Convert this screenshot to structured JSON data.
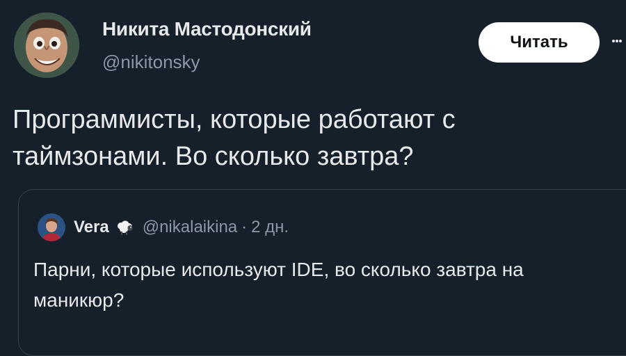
{
  "author": {
    "name": "Никита Мастодонский",
    "handle": "@nikitonsky"
  },
  "follow_button": {
    "label": "Читать"
  },
  "tweet": {
    "text": "Программисты, которые работают с таймзонами. Во сколько завтра?"
  },
  "quoted_tweet": {
    "name": "Vera",
    "badge_icon": "sheep-icon",
    "handle": "@nikalaikina",
    "separator": "·",
    "time": "2 дн.",
    "text": "Парни, которые используют IDE, во сколько завтра на маникюр?"
  },
  "colors": {
    "background": "#15202b",
    "text_primary": "#e7e9ea",
    "text_secondary": "#8b98a5",
    "button_bg": "#ffffff",
    "border": "#38444d"
  }
}
